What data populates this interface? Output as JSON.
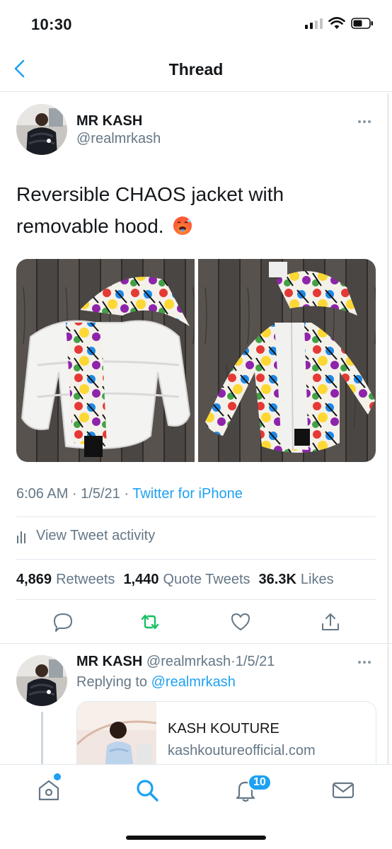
{
  "status_bar": {
    "time": "10:30"
  },
  "nav": {
    "title": "Thread"
  },
  "tweet": {
    "author_name": "MR KASH",
    "author_handle": "@realmrkash",
    "text": "Reversible CHAOS jacket with removable hood.",
    "emoji": "hot-face-emoji",
    "time": "6:06 AM",
    "date": "1/5/21",
    "source": "Twitter for iPhone",
    "activity_label": "View Tweet activity",
    "stats": {
      "retweets_count": "4,869",
      "retweets_label": "Retweets",
      "quotes_count": "1,440",
      "quotes_label": "Quote Tweets",
      "likes_count": "36.3K",
      "likes_label": "Likes"
    },
    "media": [
      "jacket-photo-white-side",
      "jacket-photo-print-side"
    ]
  },
  "reply": {
    "author_name": "MR KASH",
    "author_handle": "@realmrkash",
    "date": "1/5/21",
    "replying_prefix": "Replying to",
    "replying_handle": "@realmrkash",
    "card": {
      "title": "KASH KOUTURE",
      "domain": "kashkoutureofficial.com"
    }
  },
  "tabbar": {
    "items": [
      "home-icon",
      "search-icon",
      "notifications-icon",
      "messages-icon"
    ],
    "notification_count": "10"
  },
  "colors": {
    "accent": "#1da1f2",
    "retweet_green": "#17bf63",
    "text_secondary": "#657786"
  }
}
